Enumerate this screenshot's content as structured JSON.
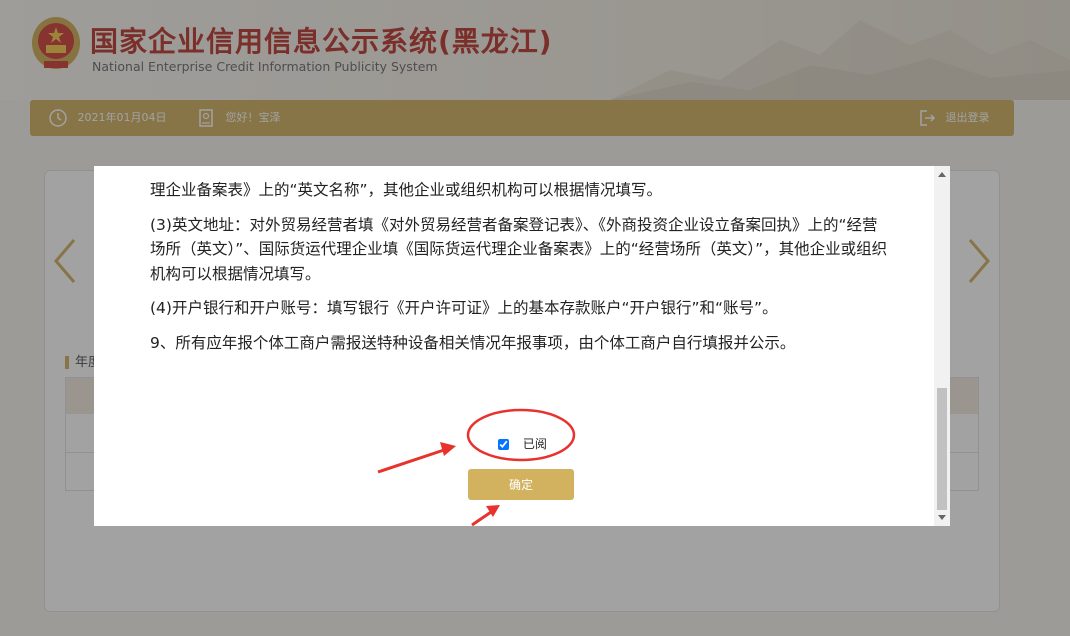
{
  "header": {
    "title": "国家企业信用信息公示系统(黑龙江)",
    "subtitle": "National Enterprise Credit Information Publicity System"
  },
  "topbar": {
    "date": "2021年01月04日",
    "greeting": "您好！宝泽",
    "logout": "退出登录"
  },
  "panel": {
    "heading": "年度"
  },
  "modal": {
    "paragraphs": [
      "理企业备案表》上的“英文名称”，其他企业或组织机构可以根据情况填写。",
      "(3)英文地址：对外贸易经营者填《对外贸易经营者备案登记表》、《外商投资企业设立备案回执》上的“经营场所（英文）”、国际货运代理企业填《国际货运代理企业备案表》上的“经营场所（英文）”，其他企业或组织机构可以根据情况填写。",
      "(4)开户银行和开户账号：填写银行《开户许可证》上的基本存款账户“开户银行”和“账号”。",
      "9、所有应年报个体工商户需报送特种设备相关情况年报事项，由个体工商户自行填报并公示。"
    ],
    "checkbox_label": "已阅",
    "checkbox_checked": true,
    "confirm_label": "确定"
  },
  "colors": {
    "brand_red": "#b0190f",
    "gold": "#c9a44a",
    "button_gold": "#d2b25f",
    "annotation_red": "#e8322d"
  },
  "icons": [
    "national-emblem-icon",
    "clock-icon",
    "user-card-icon",
    "logout-icon",
    "chevron-left-icon",
    "chevron-right-icon"
  ]
}
